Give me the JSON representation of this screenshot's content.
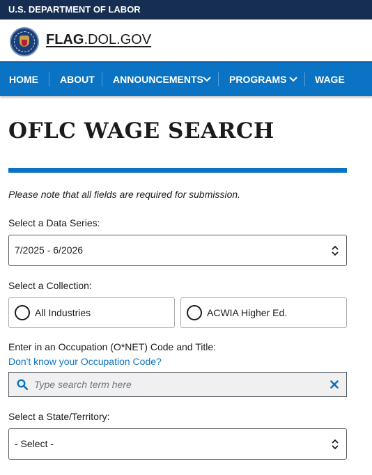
{
  "gov_banner": {
    "text": "U.S. DEPARTMENT OF LABOR"
  },
  "header": {
    "site_name_bold": "FLAG",
    "site_name_rest": ".DOL.GOV"
  },
  "nav": {
    "items": [
      {
        "label": "HOME",
        "has_dropdown": false
      },
      {
        "label": "ABOUT",
        "has_dropdown": false
      },
      {
        "label": "ANNOUNCEMENTS",
        "has_dropdown": true
      },
      {
        "label": "PROGRAMS",
        "has_dropdown": true
      },
      {
        "label": "WAGE DATA",
        "has_dropdown": false
      }
    ]
  },
  "page": {
    "title": "OFLC WAGE SEARCH",
    "note": "Please note that all fields are required for submission."
  },
  "form": {
    "data_series": {
      "label": "Select a Data Series:",
      "selected": "7/2025 - 6/2026"
    },
    "collection": {
      "label": "Select a Collection:",
      "options": [
        {
          "label": "All Industries",
          "selected": false
        },
        {
          "label": "ACWIA Higher Ed.",
          "selected": false
        }
      ]
    },
    "occupation": {
      "label": "Enter in an Occupation (O*NET) Code and Title:",
      "help_link": "Don't know your Occupation Code?",
      "placeholder": "Type search term here",
      "value": ""
    },
    "state": {
      "label": "Select a State/Territory:",
      "selected": "- Select -"
    }
  },
  "colors": {
    "banner_bg": "#162e51",
    "nav_bg": "#0a73c4",
    "accent_rule": "#0a73c4",
    "link": "#0a73c4"
  },
  "icons": {
    "seal": "dol-seal-icon",
    "nav_dropdown": "chevron-down-icon",
    "select_arrows": "updown-arrows-icon",
    "search": "search-icon",
    "clear": "close-icon"
  }
}
